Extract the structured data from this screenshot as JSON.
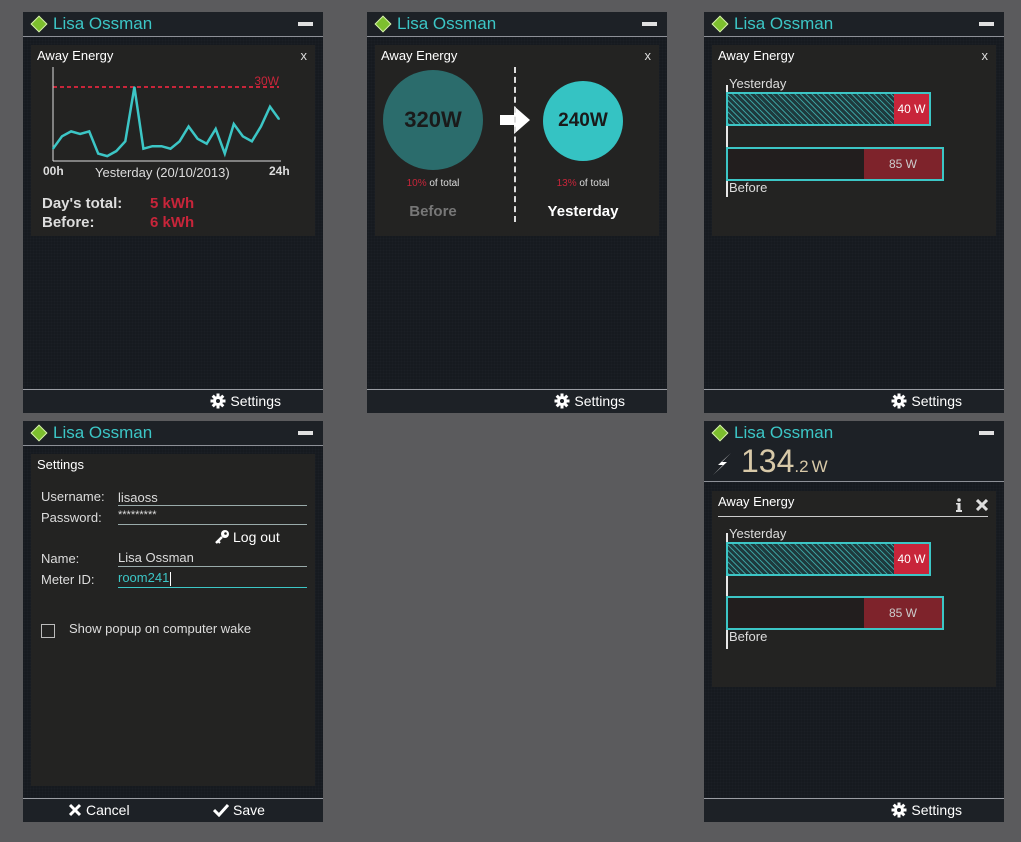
{
  "user": {
    "name": "Lisa Ossman"
  },
  "panel1": {
    "card_title": "Away Energy",
    "close": "x",
    "threshold_label": "30W",
    "x_start": "00h",
    "x_end": "24h",
    "x_label": "Yesterday (20/10/2013)",
    "day_total_label": "Day's total:",
    "day_total_value": "5 kWh",
    "before_label": "Before:",
    "before_value": "6 kWh",
    "settings": "Settings"
  },
  "panel2": {
    "card_title": "Away Energy",
    "close": "x",
    "before_value": "320W",
    "before_pct": "10%",
    "before_pct_suffix": " of total",
    "before_label": "Before",
    "yesterday_value": "240W",
    "yesterday_pct": "13%",
    "yesterday_pct_suffix": " of total",
    "yesterday_label": "Yesterday",
    "settings": "Settings"
  },
  "panel3": {
    "card_title": "Away Energy",
    "close": "x",
    "yesterday_label": "Yesterday",
    "yesterday_value": "40 W",
    "before_value": "85 W",
    "before_label": "Before",
    "settings": "Settings"
  },
  "panel4": {
    "card_title": "Settings",
    "username_label": "Username:",
    "username_value": "lisaoss",
    "password_label": "Password:",
    "password_value": "*********",
    "logout": "Log out",
    "name_label": "Name:",
    "name_value": "Lisa Ossman",
    "meter_label": "Meter ID:",
    "meter_value": "room241",
    "checkbox_label": "Show popup on computer wake",
    "cancel": "Cancel",
    "save": "Save"
  },
  "panel5": {
    "power_value": "134",
    "power_decimal": ".2",
    "power_unit": "W",
    "card_title": "Away Energy",
    "yesterday_label": "Yesterday",
    "yesterday_value": "40 W",
    "before_value": "85 W",
    "before_label": "Before",
    "settings": "Settings"
  },
  "colors": {
    "accent": "#3cc6c6",
    "alert": "#c8253a",
    "brand": "#7dbf2e"
  },
  "chart_data": {
    "type": "line",
    "xlabel": "Yesterday (20/10/2013)",
    "x_range": [
      "00h",
      "24h"
    ],
    "threshold": 30,
    "threshold_label": "30W",
    "values": [
      5,
      10,
      12,
      11,
      12,
      3,
      2,
      4,
      8,
      30,
      5,
      6,
      6,
      5,
      8,
      14,
      9,
      7,
      13,
      3,
      15,
      10,
      8,
      14,
      22,
      17
    ]
  }
}
